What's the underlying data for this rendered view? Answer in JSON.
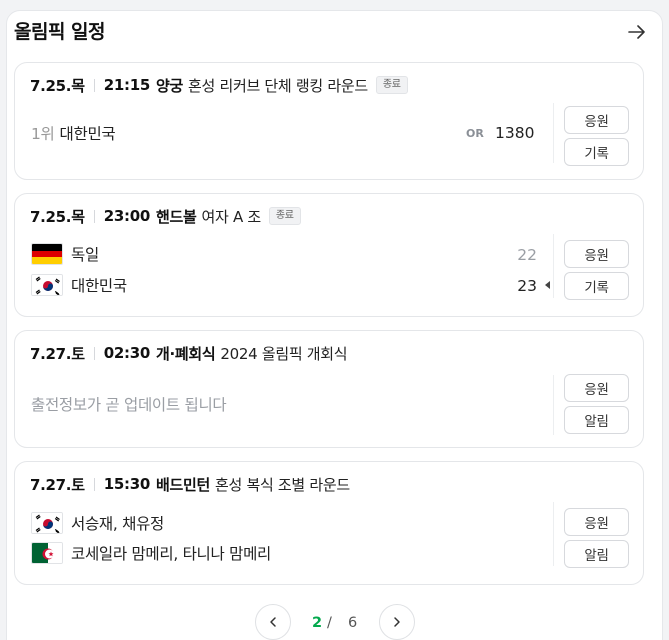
{
  "header": {
    "title": "올림픽 일정",
    "more_icon": "arrow-right-icon"
  },
  "matches": [
    {
      "date": "7.25.목",
      "time": "21:15",
      "sport": "양궁",
      "event": "혼성 리커브 단체 랭킹 라운드",
      "status": "종료",
      "rank": "1위",
      "team": "대한민국",
      "record_label": "OR",
      "record_value": "1380",
      "buttons": [
        "응원",
        "기록"
      ]
    },
    {
      "date": "7.25.목",
      "time": "23:00",
      "sport": "핸드볼",
      "event": "여자 A 조",
      "status": "종료",
      "teams": [
        {
          "flag": "germany-flag-icon",
          "name": "독일",
          "score": "22",
          "winner": false
        },
        {
          "flag": "korea-flag-icon",
          "name": "대한민국",
          "score": "23",
          "winner": true
        }
      ],
      "buttons": [
        "응원",
        "기록"
      ]
    },
    {
      "date": "7.27.토",
      "time": "02:30",
      "sport": "개·폐회식",
      "event": "2024 올림픽 개회식",
      "message": "출전정보가 곧 업데이트 됩니다",
      "buttons": [
        "응원",
        "알림"
      ]
    },
    {
      "date": "7.27.토",
      "time": "15:30",
      "sport": "배드민턴",
      "event": "혼성 복식 조별 라운드",
      "teams": [
        {
          "flag": "korea-flag-icon",
          "name": "서승재, 채유정"
        },
        {
          "flag": "algeria-flag-icon",
          "name": "코세일라 맘메리, 타니나 맘메리"
        }
      ],
      "buttons": [
        "응원",
        "알림"
      ]
    }
  ],
  "pagination": {
    "current": "2",
    "separator": "/",
    "total": "6"
  },
  "colors": {
    "accent": "#03a94d",
    "border": "#e4e6e9",
    "muted": "#9a9ea4"
  }
}
